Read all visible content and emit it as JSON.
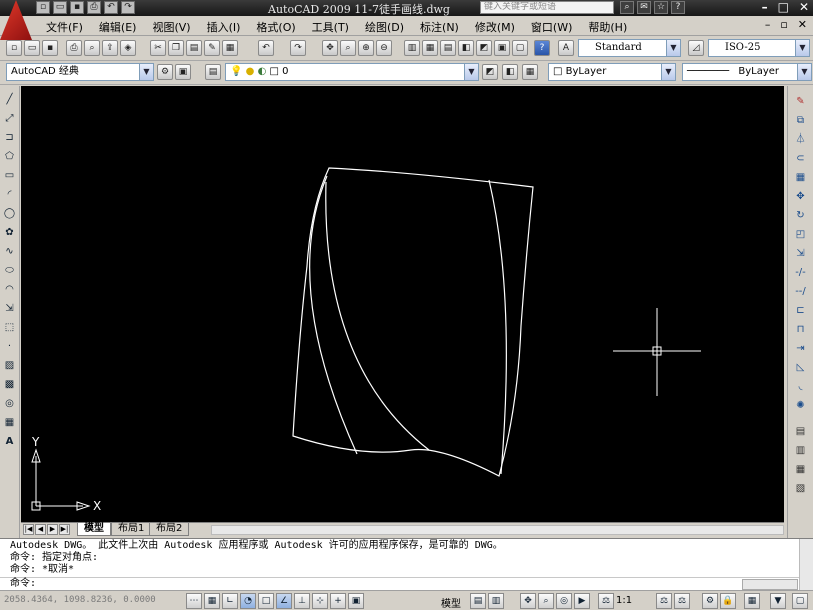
{
  "window": {
    "title": "AutoCAD 2009  11-7徒手画线.dwg",
    "search_placeholder": "键入关键字或短语"
  },
  "quick_access": [
    "new-icon",
    "open-icon",
    "save-icon",
    "print-icon",
    "undo-icon",
    "redo-icon"
  ],
  "menu": {
    "items": [
      "文件(F)",
      "编辑(E)",
      "视图(V)",
      "插入(I)",
      "格式(O)",
      "工具(T)",
      "绘图(D)",
      "标注(N)",
      "修改(M)",
      "窗口(W)",
      "帮助(H)"
    ]
  },
  "toolbar": {
    "text_style": "Standard",
    "dim_style": "ISO-25"
  },
  "workspace": {
    "name": "AutoCAD 经典"
  },
  "layers": {
    "current": "0",
    "color": "ByLayer",
    "linetype": "ByLayer"
  },
  "canvas": {
    "background": "#000000",
    "line_color": "#ffffff",
    "ucs_x": "X",
    "ucs_y": "Y"
  },
  "tabs": {
    "items": [
      "模型",
      "布局1",
      "布局2"
    ],
    "active": "模型"
  },
  "command": {
    "lines": [
      "Autodesk DWG。   此文件上次由 Autodesk 应用程序或 Autodesk 许可的应用程序保存，是可靠的 DWG。",
      "命令: 指定对角点:",
      "命令: *取消*"
    ],
    "prompt": "命令:"
  },
  "status": {
    "coords": "2058.4364, 1098.8236, 0.0000",
    "model": "模型",
    "scale": "1:1"
  }
}
